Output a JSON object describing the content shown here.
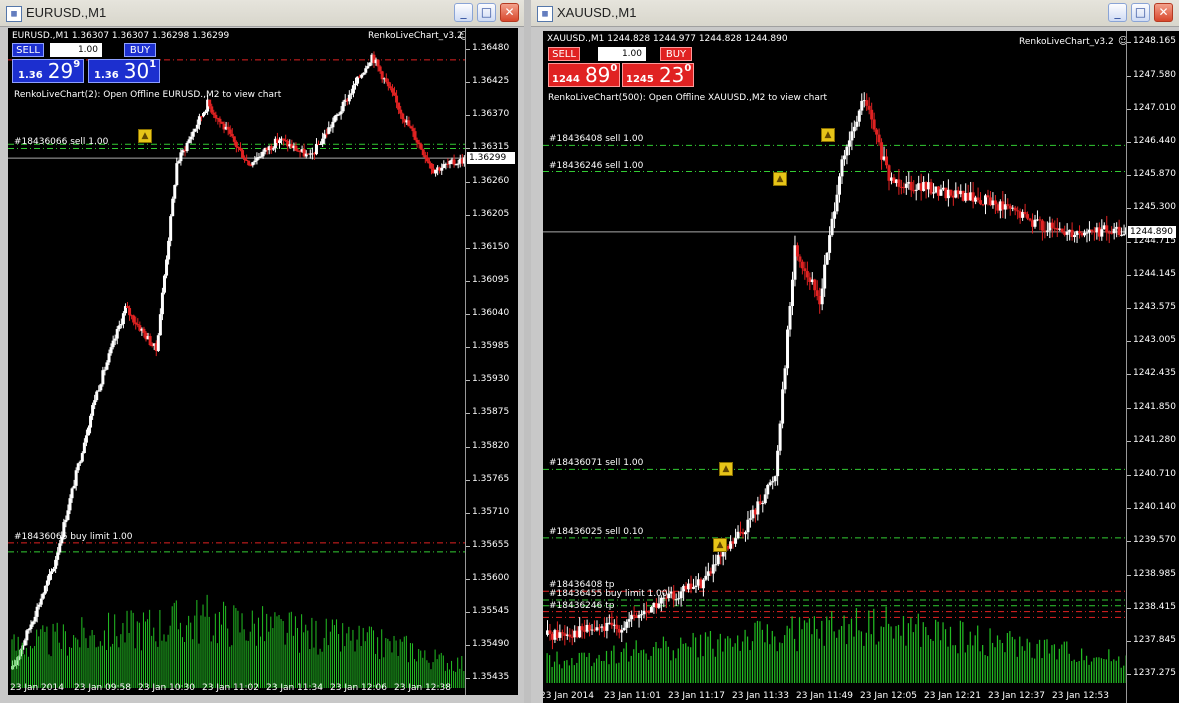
{
  "colors": {
    "up": "#ffffff",
    "down": "#e02222",
    "volume": "#22bb22",
    "sell_line": "#33cc33",
    "limit_line": "#e02222",
    "sell_button": "#e02222",
    "blue_panel": "#1c2fcf"
  },
  "icons": {
    "window": "mt4-window-icon",
    "minimize": "minimize-icon",
    "maximize": "maximize-icon",
    "close": "close-icon",
    "smiley": "smiley-icon",
    "trade_marker": "trade-arrow-icon"
  },
  "left": {
    "title": "EURUSD.,M1",
    "symbol_line": "EURUSD.,M1  1.36307 1.36307 1.36298 1.36299",
    "indicator": "RenkoLiveChart_v3.2",
    "info": "RenkoLiveChart(2): Open Offline EURUSD.,M2 to view chart",
    "panel": {
      "sell_label": "SELL",
      "buy_label": "BUY",
      "lot": "1.00",
      "sell_small": "1.36",
      "sell_big": "29",
      "sell_sup": "9",
      "buy_small": "1.36",
      "buy_big": "30",
      "buy_sup": "1"
    },
    "current_price": "1.36299",
    "current_value": 1.36299,
    "price_min": 1.35419,
    "price_max": 1.36515,
    "price_labels": [
      "1.36480",
      "1.36425",
      "1.36370",
      "1.36315",
      "1.36260",
      "1.36205",
      "1.36150",
      "1.36095",
      "1.36040",
      "1.35985",
      "1.35930",
      "1.35875",
      "1.35820",
      "1.35765",
      "1.35710",
      "1.35655",
      "1.35600",
      "1.35545",
      "1.35490",
      "1.35435"
    ],
    "time_labels": [
      "23 Jan 2014",
      "23 Jan 09:58",
      "23 Jan 10:30",
      "23 Jan 11:02",
      "23 Jan 11:34",
      "23 Jan 12:06",
      "23 Jan 12:38"
    ],
    "orders": [
      {
        "label": "#18436066 sell 1.00",
        "price": 1.36315,
        "kind": "sell"
      },
      {
        "label": "",
        "price": 1.36462,
        "kind": "limit"
      },
      {
        "label": "",
        "price": 1.36322,
        "kind": "sell"
      },
      {
        "label": "#18436066 buy limit 1.00",
        "price": 1.3566,
        "kind": "limit"
      },
      {
        "label": "",
        "price": 1.35645,
        "kind": "sell"
      }
    ]
  },
  "right": {
    "title": "XAUUSD.,M1",
    "symbol_line": "XAUUSD.,M1  1244.828 1244.977 1244.828 1244.890",
    "indicator": "RenkoLiveChart_v3.2",
    "info": "RenkoLiveChart(500): Open Offline XAUUSD.,M2 to view chart",
    "panel": {
      "sell_label": "SELL",
      "buy_label": "BUY",
      "lot": "1.00",
      "sell_small": "1244",
      "sell_big": "89",
      "sell_sup": "0",
      "buy_small": "1245",
      "buy_big": "23",
      "buy_sup": "0"
    },
    "current_price": "1244.890",
    "current_value": 1244.89,
    "price_min": 1237.12,
    "price_max": 1248.35,
    "price_labels": [
      "1248.165",
      "1247.580",
      "1247.010",
      "1246.440",
      "1245.870",
      "1245.300",
      "1244.715",
      "1244.145",
      "1243.575",
      "1243.005",
      "1242.435",
      "1241.850",
      "1241.280",
      "1240.710",
      "1240.140",
      "1239.570",
      "1238.985",
      "1238.415",
      "1237.845",
      "1237.275"
    ],
    "time_labels": [
      "23 Jan 2014",
      "23 Jan 11:01",
      "23 Jan 11:17",
      "23 Jan 11:33",
      "23 Jan 11:49",
      "23 Jan 12:05",
      "23 Jan 12:21",
      "23 Jan 12:37",
      "23 Jan 12:53"
    ],
    "orders": [
      {
        "label": "#18436408 sell 1.00",
        "price": 1246.38,
        "kind": "sell"
      },
      {
        "label": "#18436246 sell 1.00",
        "price": 1245.93,
        "kind": "sell"
      },
      {
        "label": "#18436071 sell 1.00",
        "price": 1240.8,
        "kind": "sell"
      },
      {
        "label": "#18436025 sell 0.10",
        "price": 1239.62,
        "kind": "sell"
      },
      {
        "label": "#18436408 tp",
        "price": 1238.7,
        "kind": "limit"
      },
      {
        "label": "#18436455 buy limit 1.00",
        "price": 1238.55,
        "kind": "sell"
      },
      {
        "label": "",
        "price": 1238.45,
        "kind": "sell"
      },
      {
        "label": "#18436246 tp",
        "price": 1238.35,
        "kind": "limit"
      },
      {
        "label": "",
        "price": 1238.25,
        "kind": "limit"
      }
    ]
  }
}
